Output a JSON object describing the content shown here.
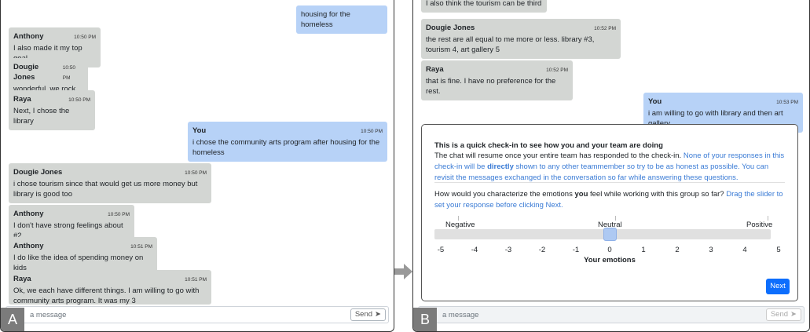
{
  "panelA": {
    "label": "A",
    "messages": [
      {
        "from": "me",
        "name": "",
        "time": "",
        "text": "housing for the homeless"
      },
      {
        "from": "them",
        "name": "Anthony",
        "time": "10:50 PM",
        "text": "I also made it my top goal"
      },
      {
        "from": "them",
        "name": "Dougie Jones",
        "time": "10:50 PM",
        "text": "wonderful. we rock"
      },
      {
        "from": "them",
        "name": "Raya",
        "time": "10:50 PM",
        "text": "Next, I chose the library"
      },
      {
        "from": "me",
        "name": "You",
        "time": "10:50 PM",
        "text": "i chose the community arts program after housing for the homeless"
      },
      {
        "from": "them",
        "name": "Dougie Jones",
        "time": "10:50 PM",
        "text": "i chose tourism since that would get us more money but library is good too"
      },
      {
        "from": "them",
        "name": "Anthony",
        "time": "10:50 PM",
        "text": "I don't have strong feelings about #2"
      },
      {
        "from": "them",
        "name": "Anthony",
        "time": "10:51 PM",
        "text": "I do like the idea of spending money on kids"
      },
      {
        "from": "them",
        "name": "Raya",
        "time": "10:51 PM",
        "text": "Ok, we each have different things. I am willing to go with community arts program. It was my 3"
      }
    ],
    "input_placeholder": "a message",
    "send_label": "Send"
  },
  "panelB": {
    "label": "B",
    "messages": [
      {
        "from": "them",
        "name": "",
        "time": "",
        "text": "I also think the tourism can be third"
      },
      {
        "from": "them",
        "name": "Dougie Jones",
        "time": "10:52 PM",
        "text": "the rest are all equal to me more or less. library #3, tourism 4, art gallery 5"
      },
      {
        "from": "them",
        "name": "Raya",
        "time": "10:52 PM",
        "text": "that is fine. I have no preference for the rest."
      },
      {
        "from": "me",
        "name": "You",
        "time": "10:53 PM",
        "text": "i am willing to go with library and then art gallery"
      }
    ],
    "checkin": {
      "title": "This is a quick check-in to see how you and your team are doing",
      "body_plain": "The chat will resume once your entire team has responded to the check-in. ",
      "body_blue_1": "None of your responses in this check-in will be ",
      "body_bold": "directly",
      "body_blue_2": " shown to any other teammember so try to be as honest as possible. You can revisit the messages exchanged in the conversation so far while answering these questions.",
      "question_1": "How would you characterize the emotions ",
      "question_bold": "you",
      "question_2": " feel while working with this group so far? ",
      "question_hint": "Drag the slider to set your response before clicking Next.",
      "label_negative": "Negative",
      "label_neutral": "Neutral",
      "label_positive": "Positive",
      "scale": [
        "-5",
        "-4",
        "-3",
        "-2",
        "-1",
        "0",
        "1",
        "2",
        "3",
        "4",
        "5"
      ],
      "slider_value": 0,
      "axis_label": "Your emotions",
      "next_label": "Next"
    },
    "input_placeholder": "a message",
    "send_label": "Send"
  },
  "colors": {
    "my_bubble": "#b7d2f7",
    "their_bubble": "#d3d6d3",
    "accent": "#0d6efd",
    "hint": "#3a7bd5"
  }
}
